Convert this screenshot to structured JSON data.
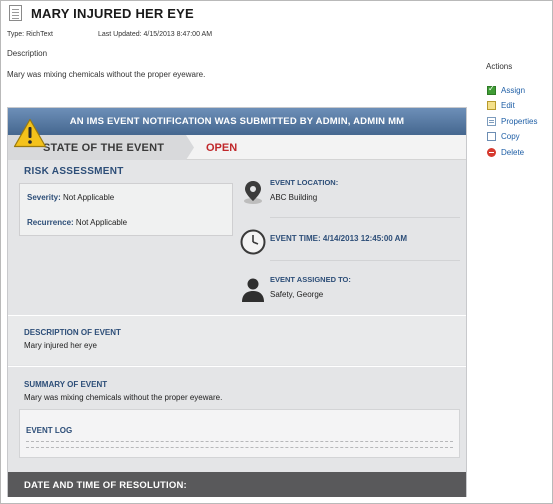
{
  "header": {
    "title": "MARY INJURED HER EYE",
    "type_text": "Type: RichText",
    "last_updated": "Last Updated: 4/15/2013 8:47:00 AM",
    "description_label": "Description",
    "description_text": "Mary was mixing chemicals without the proper eyeware."
  },
  "actions": {
    "title": "Actions",
    "items": [
      {
        "label": "Assign",
        "icon": "assign-icon"
      },
      {
        "label": "Edit",
        "icon": "edit-icon"
      },
      {
        "label": "Properties",
        "icon": "properties-icon"
      },
      {
        "label": "Copy",
        "icon": "copy-icon"
      },
      {
        "label": "Delete",
        "icon": "delete-icon"
      }
    ]
  },
  "notification": {
    "banner": "AN IMS EVENT NOTIFICATION WAS SUBMITTED BY ADMIN, ADMIN MM",
    "state_label": "STATE OF THE EVENT",
    "state_value": "OPEN"
  },
  "risk": {
    "title": "RISK ASSESSMENT",
    "severity_label": "Severity:",
    "severity_value": "Not Applicable",
    "recurrence_label": "Recurrence:",
    "recurrence_value": "Not Applicable"
  },
  "event_info": {
    "location_head": "EVENT LOCATION:",
    "location_value": "ABC Building",
    "time_head": "EVENT TIME: 4/14/2013 12:45:00 AM",
    "assigned_head": "EVENT ASSIGNED TO:",
    "assigned_value": "Safety, George"
  },
  "description": {
    "head": "DESCRIPTION OF EVENT",
    "text": "Mary injured her eye"
  },
  "summary": {
    "head": "SUMMARY OF EVENT",
    "text": "Mary was mixing chemicals without the proper eyeware."
  },
  "event_log": {
    "head": "EVENT LOG"
  },
  "resolution": {
    "head": "DATE AND TIME OF RESOLUTION:"
  },
  "colors": {
    "banner": "#45678f",
    "open_state": "#c0282b",
    "heading_blue": "#2d4e78",
    "link": "#1f5fa6",
    "footer": "#59595b"
  }
}
